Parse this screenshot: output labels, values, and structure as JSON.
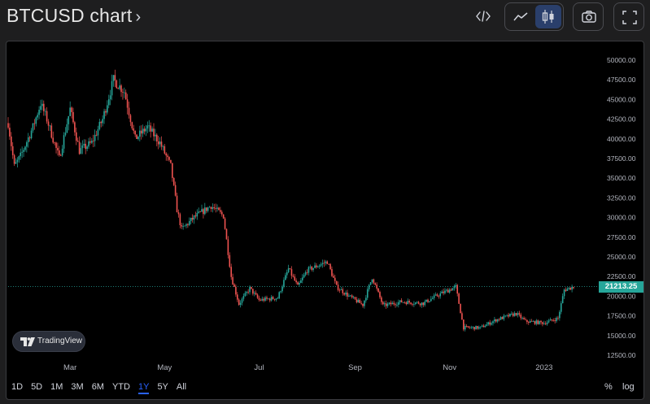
{
  "header": {
    "title": "BTCUSD chart",
    "chevron": "›"
  },
  "toolbar": {
    "embed_icon": "code-embed-icon",
    "line_style_icon": "line-chart-icon",
    "candle_style_icon": "candlestick-icon",
    "snapshot_icon": "camera-icon",
    "fullscreen_icon": "fullscreen-icon",
    "active_style": "candles"
  },
  "chart_data": {
    "type": "candlestick",
    "symbol": "BTCUSD",
    "y_axis": {
      "ticks": [
        "50000.00",
        "47500.00",
        "45000.00",
        "42500.00",
        "40000.00",
        "37500.00",
        "35000.00",
        "32500.00",
        "30000.00",
        "27500.00",
        "25000.00",
        "22500.00",
        "20000.00",
        "17500.00",
        "15000.00",
        "12500.00"
      ],
      "min": 12500,
      "max": 50000
    },
    "x_axis": {
      "ticks": [
        "Mar",
        "May",
        "Jul",
        "Sep",
        "Nov",
        "2023"
      ]
    },
    "last_price": "21213.25",
    "last_price_value": 21213.25,
    "up_color": "#26a69a",
    "down_color": "#ef5350",
    "close_path": [
      [
        "2022-01-20",
        42000
      ],
      [
        "2022-01-24",
        36500
      ],
      [
        "2022-01-28",
        37800
      ],
      [
        "2022-02-05",
        41500
      ],
      [
        "2022-02-10",
        44500
      ],
      [
        "2022-02-14",
        42500
      ],
      [
        "2022-02-22",
        37500
      ],
      [
        "2022-03-01",
        43800
      ],
      [
        "2022-03-07",
        38500
      ],
      [
        "2022-03-15",
        39500
      ],
      [
        "2022-03-22",
        42500
      ],
      [
        "2022-03-29",
        47500
      ],
      [
        "2022-04-05",
        46000
      ],
      [
        "2022-04-12",
        40000
      ],
      [
        "2022-04-20",
        41500
      ],
      [
        "2022-04-28",
        39500
      ],
      [
        "2022-05-05",
        36500
      ],
      [
        "2022-05-09",
        31000
      ],
      [
        "2022-05-12",
        28500
      ],
      [
        "2022-05-20",
        30000
      ],
      [
        "2022-05-31",
        31500
      ],
      [
        "2022-06-08",
        30200
      ],
      [
        "2022-06-13",
        22500
      ],
      [
        "2022-06-18",
        19000
      ],
      [
        "2022-06-25",
        21000
      ],
      [
        "2022-07-01",
        19500
      ],
      [
        "2022-07-13",
        19800
      ],
      [
        "2022-07-20",
        23500
      ],
      [
        "2022-07-26",
        21200
      ],
      [
        "2022-08-01",
        23300
      ],
      [
        "2022-08-14",
        24400
      ],
      [
        "2022-08-20",
        21200
      ],
      [
        "2022-08-28",
        20000
      ],
      [
        "2022-09-06",
        18900
      ],
      [
        "2022-09-12",
        22400
      ],
      [
        "2022-09-19",
        18800
      ],
      [
        "2022-10-01",
        19300
      ],
      [
        "2022-10-15",
        19100
      ],
      [
        "2022-10-25",
        20200
      ],
      [
        "2022-11-05",
        21200
      ],
      [
        "2022-11-09",
        17000
      ],
      [
        "2022-11-10",
        16000
      ],
      [
        "2022-11-21",
        16000
      ],
      [
        "2022-12-01",
        17000
      ],
      [
        "2022-12-14",
        17800
      ],
      [
        "2022-12-20",
        16800
      ],
      [
        "2023-01-01",
        16600
      ],
      [
        "2023-01-10",
        17200
      ],
      [
        "2023-01-14",
        20800
      ],
      [
        "2023-01-20",
        21213
      ]
    ]
  },
  "watermark": {
    "label": "TradingView",
    "icon": "tradingview-logo-icon"
  },
  "ranges": [
    "1D",
    "5D",
    "1M",
    "3M",
    "6M",
    "YTD",
    "1Y",
    "5Y",
    "All"
  ],
  "active_range": "1Y",
  "options": {
    "percent": "%",
    "log": "log"
  }
}
